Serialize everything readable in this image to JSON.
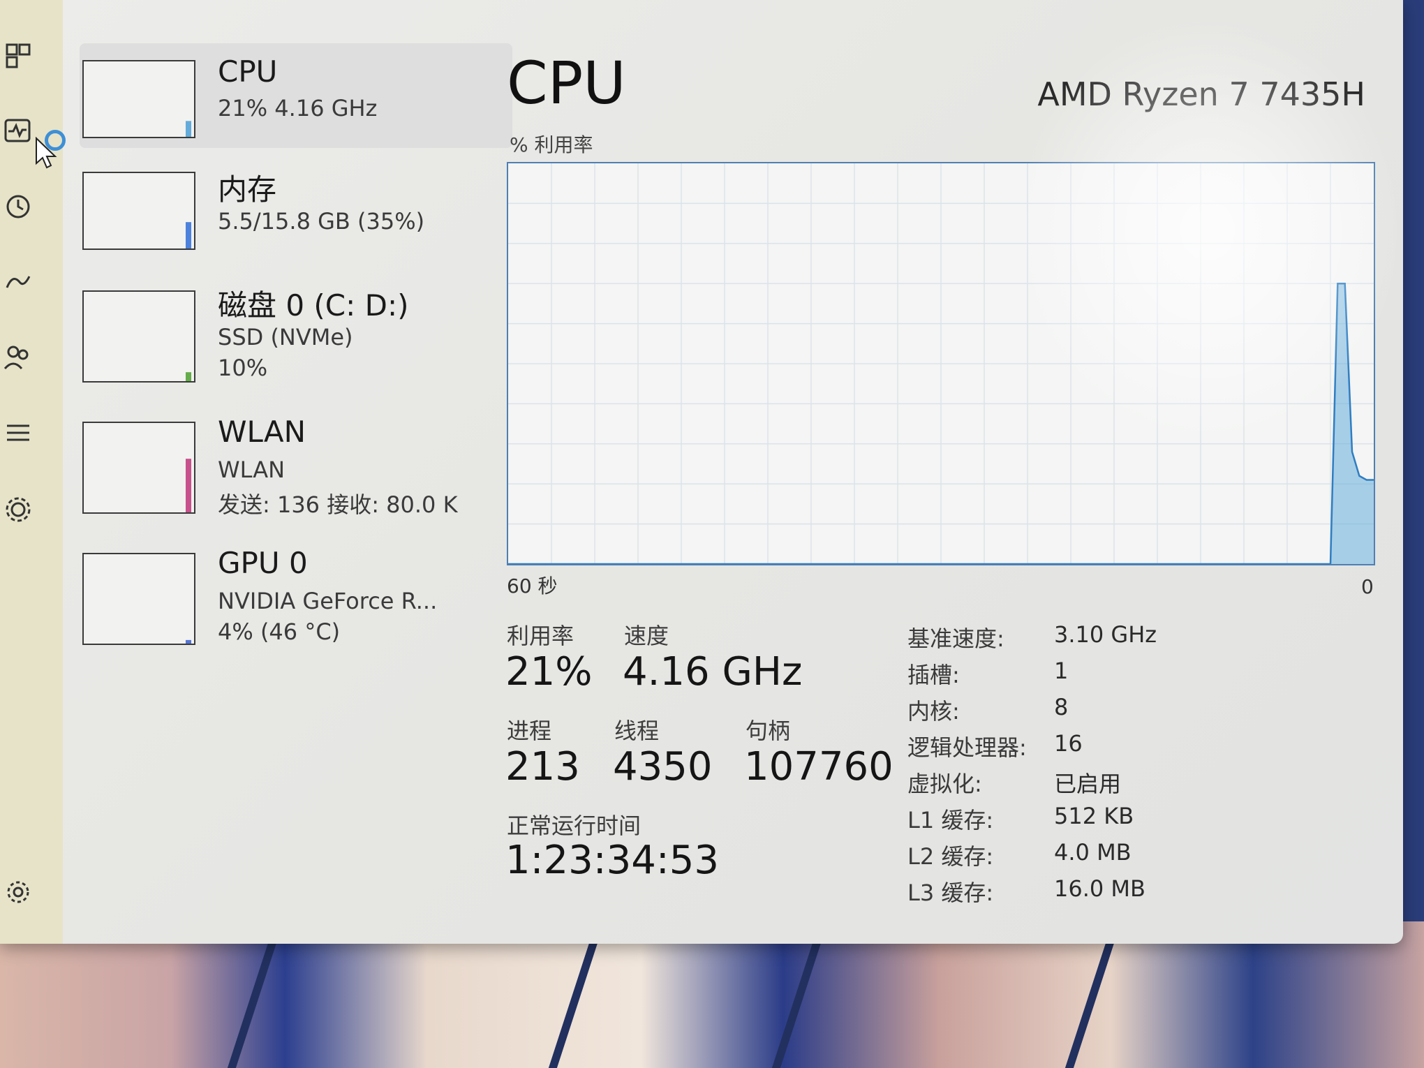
{
  "rail": {
    "icons": [
      "processes-icon",
      "performance-icon",
      "app-history-icon",
      "startup-apps-icon",
      "users-icon",
      "details-icon",
      "services-icon",
      "settings-icon"
    ]
  },
  "sidebar": {
    "items": [
      {
        "title": "CPU",
        "lines": [
          "21% 4.16 GHz"
        ],
        "color": "#4a9fd6",
        "level": 0.21
      },
      {
        "title": "内存",
        "lines": [
          "5.5/15.8 GB (35%)"
        ],
        "color": "#2f6fd8",
        "level": 0.35
      },
      {
        "title": "磁盘 0 (C: D:)",
        "lines": [
          "SSD (NVMe)",
          "10%"
        ],
        "color": "#4aa02c",
        "level": 0.1
      },
      {
        "title": "WLAN",
        "lines": [
          "WLAN",
          "发送: 136 接收: 80.0 K"
        ],
        "color": "#c0357a",
        "level": 0.6
      },
      {
        "title": "GPU 0",
        "lines": [
          "NVIDIA GeForce R...",
          "4% (46 °C)"
        ],
        "color": "#3a5fd0",
        "level": 0.04
      }
    ]
  },
  "main": {
    "title": "CPU",
    "model": "AMD Ryzen 7 7435H",
    "utilization_label": "% 利用率",
    "axis_left": "60 秒",
    "axis_right": "0",
    "graph_color": "#4a9fd6",
    "stats": {
      "utilization": {
        "label": "利用率",
        "value": "21%"
      },
      "speed": {
        "label": "速度",
        "value": "4.16 GHz"
      },
      "processes": {
        "label": "进程",
        "value": "213"
      },
      "threads": {
        "label": "线程",
        "value": "4350"
      },
      "handles": {
        "label": "句柄",
        "value": "107760"
      },
      "uptime": {
        "label": "正常运行时间",
        "value": "1:23:34:53"
      }
    },
    "specs": [
      {
        "key": "基准速度:",
        "value": "3.10 GHz"
      },
      {
        "key": "插槽:",
        "value": "1"
      },
      {
        "key": "内核:",
        "value": "8"
      },
      {
        "key": "逻辑处理器:",
        "value": "16"
      },
      {
        "key": "虚拟化:",
        "value": "已启用"
      },
      {
        "key": "L1 缓存:",
        "value": "512 KB"
      },
      {
        "key": "L2 缓存:",
        "value": "4.0 MB"
      },
      {
        "key": "L3 缓存:",
        "value": "16.0 MB"
      }
    ]
  },
  "chart_data": {
    "type": "area",
    "x": [
      60,
      3,
      2.5,
      2,
      1.5,
      1,
      0.5,
      0
    ],
    "values": [
      0,
      0,
      70,
      70,
      28,
      22,
      21,
      21
    ],
    "ylim": [
      0,
      100
    ],
    "xlabel": "60 秒",
    "ylabel": "% 利用率"
  }
}
